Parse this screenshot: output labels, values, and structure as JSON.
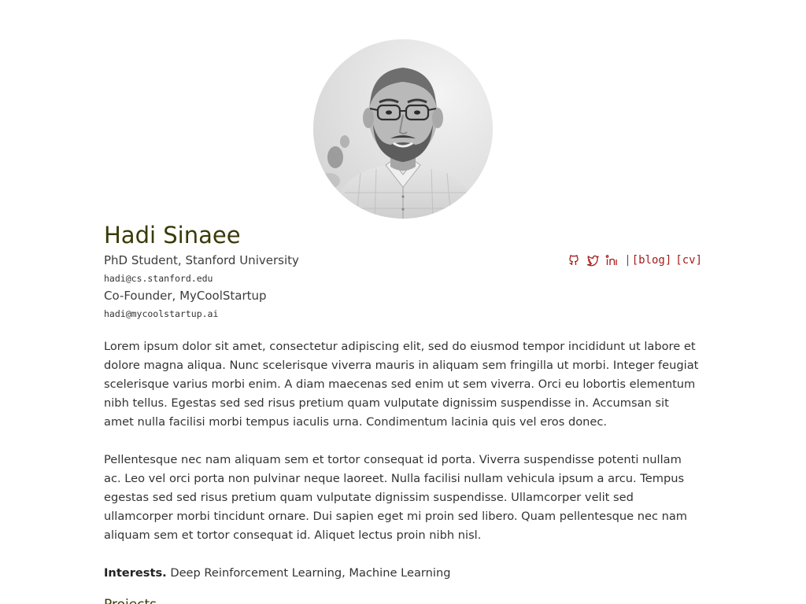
{
  "profile": {
    "name": "Hadi Sinaee",
    "affiliations": [
      {
        "title": "PhD Student, Stanford University",
        "email": "hadi@cs.stanford.edu"
      },
      {
        "title": "Co-Founder, MyCoolStartup",
        "email": "hadi@mycoolstartup.ai"
      }
    ],
    "photo_alt": "profile-photo"
  },
  "social": {
    "icons": [
      "github-icon",
      "twitter-icon",
      "linkedin-icon"
    ],
    "separator": "|",
    "links": [
      "[blog]",
      "[cv]"
    ],
    "link_color": "#a61b1b"
  },
  "bio": {
    "paragraphs": [
      "Lorem ipsum dolor sit amet, consectetur adipiscing elit, sed do eiusmod tempor incididunt ut labore et dolore magna aliqua. Nunc scelerisque viverra mauris in aliquam sem fringilla ut morbi. Integer feugiat scelerisque varius morbi enim. A diam maecenas sed enim ut sem viverra. Orci eu lobortis elementum nibh tellus. Egestas sed sed risus pretium quam vulputate dignissim suspendisse in. Accumsan sit amet nulla facilisi morbi tempus iaculis urna. Condimentum lacinia quis vel eros donec.",
      "Pellentesque nec nam aliquam sem et tortor consequat id porta. Viverra suspendisse potenti nullam ac. Leo vel orci porta non pulvinar neque laoreet. Nulla facilisi nullam vehicula ipsum a arcu. Tempus egestas sed sed risus pretium quam vulputate dignissim suspendisse. Ullamcorper velit sed ullamcorper morbi tincidunt ornare. Dui sapien eget mi proin sed libero. Quam pellentesque nec nam aliquam sem et tortor consequat id. Aliquet lectus proin nibh nisl."
    ]
  },
  "interests": {
    "label": "Interests.",
    "text": "Deep Reinforcement Learning, Machine Learning"
  },
  "sections": {
    "projects_heading": "Projects"
  },
  "colors": {
    "name": "#3a3a08",
    "accent": "#a61b1b"
  }
}
